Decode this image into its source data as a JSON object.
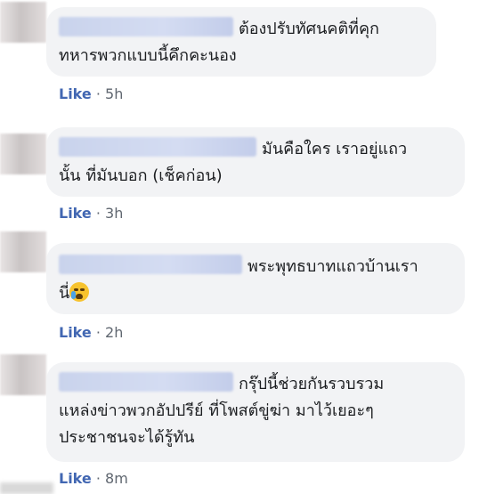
{
  "comments": [
    {
      "author_blurred": "(blurred name)",
      "lines": [
        "ต้องปรับทัศนคติที่คุก",
        "ทหารพวกแบบนี้คึกคะนอง"
      ],
      "like_label": "Like",
      "separator": "·",
      "time": "5h"
    },
    {
      "author_blurred": "(blurred name)",
      "lines": [
        "มันคือใคร เราอยู่แถว",
        "นั้น ที่มันบอก (เช็คก่อน)"
      ],
      "like_label": "Like",
      "separator": "·",
      "time": "3h"
    },
    {
      "author_blurred": "(blurred name)",
      "lines": [
        "พระพุทธบาทแถวบ้านเรา",
        "นี่"
      ],
      "emoji": "crying-face-icon",
      "like_label": "Like",
      "separator": "·",
      "time": "2h"
    },
    {
      "author_blurred": "(blurred name)",
      "lines": [
        "กรุ๊ปนี้ช่วยกันรวบรวม",
        "แหล่งข่าวพวกอัปปรีย์ ที่โพสต์ขู่ฆ่า มาไว้เยอะๆ",
        "ประชาชนจะได้รู้ทัน"
      ],
      "like_label": "Like",
      "separator": "·",
      "time": "8m"
    }
  ],
  "colors": {
    "bubble": "#f2f3f5",
    "like": "#4267b2",
    "meta": "#606770"
  }
}
